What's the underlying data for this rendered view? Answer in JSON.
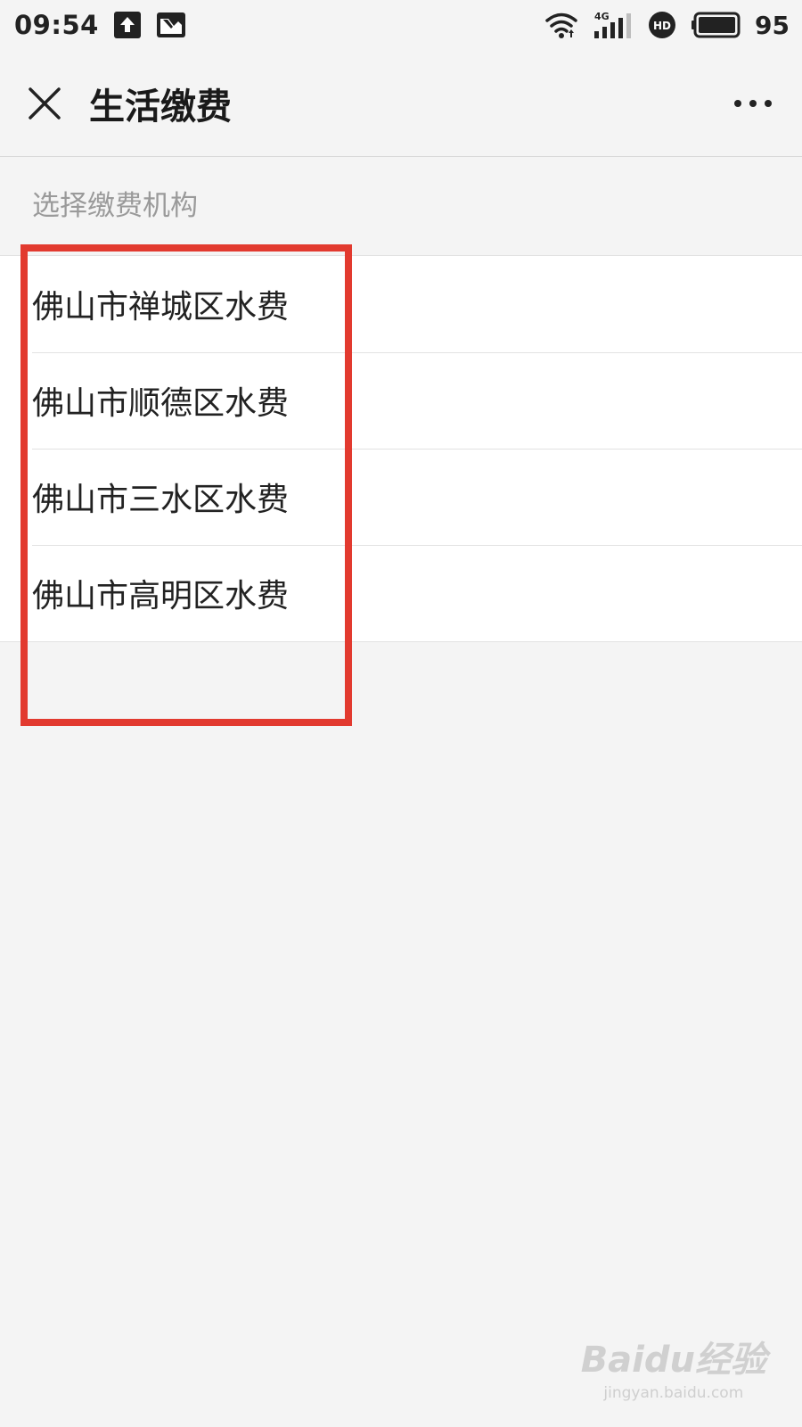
{
  "status_bar": {
    "time": "09:54",
    "icons_left": [
      "upload-icon",
      "image-icon"
    ],
    "icons_right": [
      "wifi-icon",
      "signal-4g-icon",
      "hd-icon",
      "battery-icon"
    ],
    "network": "4G",
    "hd": "HD",
    "battery": "95"
  },
  "nav": {
    "title": "生活缴费",
    "close_icon": "close-icon",
    "more_icon": "more-icon"
  },
  "section": {
    "label": "选择缴费机构"
  },
  "institutions": [
    {
      "label": "佛山市禅城区水费"
    },
    {
      "label": "佛山市顺德区水费"
    },
    {
      "label": "佛山市三水区水费"
    },
    {
      "label": "佛山市高明区水费"
    }
  ],
  "colors": {
    "background": "#f4f4f4",
    "list_background": "#ffffff",
    "highlight": "#e23a2f",
    "section_label": "#9a9a9a"
  },
  "watermark": {
    "logo": "Baidu经验",
    "url": "jingyan.baidu.com"
  }
}
